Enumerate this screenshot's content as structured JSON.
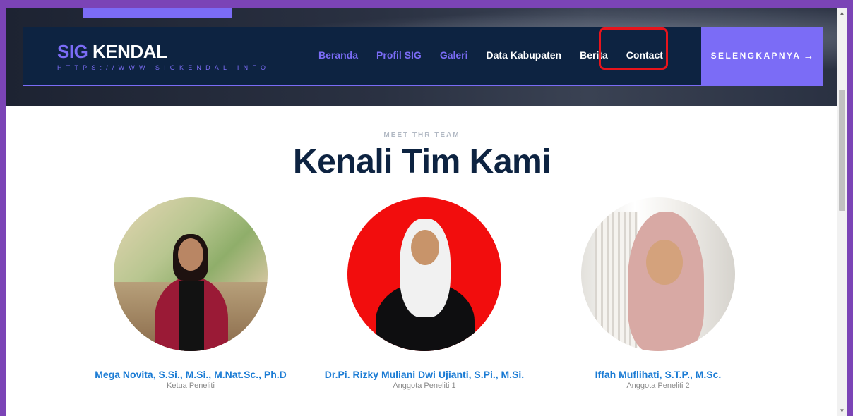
{
  "brand": {
    "title_part1": "SIG",
    "title_part2": "KENDAL",
    "url": "HTTPS://WWW.SIGKENDAL.INFO"
  },
  "nav": {
    "items": [
      {
        "label": "Beranda",
        "accent": true
      },
      {
        "label": "Profil SIG",
        "accent": true
      },
      {
        "label": "Galeri",
        "accent": true
      },
      {
        "label": "Data Kabupaten",
        "accent": false
      },
      {
        "label": "Berita",
        "accent": false
      },
      {
        "label": "Contact",
        "accent": false,
        "highlighted": true
      }
    ],
    "cta_label": "SELENGKAPNYA",
    "cta_arrow": "→"
  },
  "team": {
    "eyebrow": "MEET THR TEAM",
    "title": "Kenali Tim Kami",
    "members": [
      {
        "name": "Mega Novita, S.Si., M.Si., M.Nat.Sc., Ph.D",
        "role": "Ketua Peneliti"
      },
      {
        "name": "Dr.Pi. Rizky Muliani Dwi Ujianti, S.Pi., M.Si.",
        "role": "Anggota Peneliti 1"
      },
      {
        "name": "Iffah Muflihati, S.T.P., M.Sc.",
        "role": "Anggota Peneliti 2"
      }
    ]
  },
  "colors": {
    "frame": "#7b44b6",
    "navbar": "#0d2341",
    "accent": "#7b6cf6",
    "highlight": "#e8141c",
    "name_link": "#1a7bd4",
    "title": "#0d2341"
  },
  "icons": {
    "cta_arrow": "arrow-right-icon",
    "scroll_up": "scroll-up-arrow-icon",
    "scroll_down": "scroll-down-arrow-icon"
  }
}
